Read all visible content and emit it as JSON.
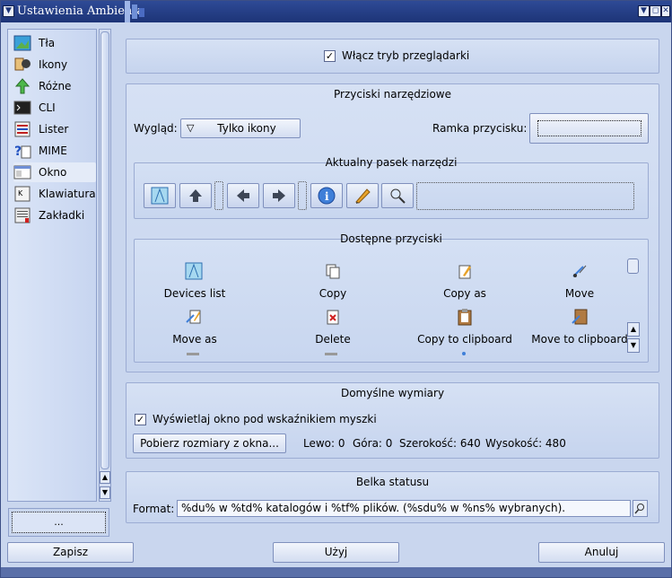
{
  "window": {
    "title": "Ustawienia Ambienta"
  },
  "sidebar": {
    "items": [
      {
        "label": "Tła",
        "icon": "wallpaper-icon"
      },
      {
        "label": "Ikony",
        "icon": "icons-icon"
      },
      {
        "label": "Różne",
        "icon": "misc-icon"
      },
      {
        "label": "CLI",
        "icon": "terminal-icon"
      },
      {
        "label": "Lister",
        "icon": "lister-icon"
      },
      {
        "label": "MIME",
        "icon": "mime-icon"
      },
      {
        "label": "Okno",
        "icon": "window-icon"
      },
      {
        "label": "Klawiatura",
        "icon": "keyboard-icon"
      },
      {
        "label": "Zakładki",
        "icon": "bookmarks-icon"
      }
    ],
    "bottom_button": "..."
  },
  "browser_mode": {
    "label": "Włącz tryb przeglądarki",
    "checked": true
  },
  "toolbar_buttons": {
    "title": "Przyciski narzędziowe",
    "look_label": "Wygląd:",
    "look_value": "Tylko ikony",
    "frame_label": "Ramka przycisku:"
  },
  "current_toolbar": {
    "title": "Aktualny pasek narzędzi"
  },
  "available": {
    "title": "Dostępne przyciski",
    "items": [
      "Devices list",
      "Copy",
      "Copy as",
      "Move",
      "Move as",
      "Delete",
      "Copy to clipboard",
      "Move to clipboard"
    ]
  },
  "default_size": {
    "title": "Domyślne wymiary",
    "pointer_label": "Wyświetlaj okno pod wskaźnikiem myszki",
    "pointer_checked": true,
    "get_size_button": "Pobierz rozmiary z okna...",
    "left": "Lewo: 0",
    "top": "Góra: 0",
    "width": "Szerokość: 640",
    "height": "Wysokość: 480"
  },
  "status_bar": {
    "title": "Belka statusu",
    "format_label": "Format:",
    "format_value": "%du% w %td% katalogów i %tf% plików. (%sdu% w %ns% wybranych)."
  },
  "footer": {
    "save": "Zapisz",
    "apply": "Użyj",
    "cancel": "Anuluj"
  },
  "colors": {
    "accent": "#1d3477",
    "background": "#c9d6ee"
  }
}
